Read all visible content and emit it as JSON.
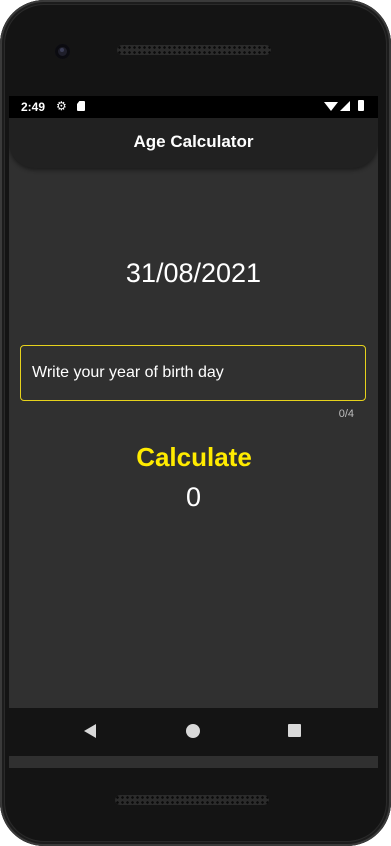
{
  "status_bar": {
    "time": "2:49",
    "icons": [
      "settings-gear-icon",
      "sd-card-icon",
      "wifi-icon",
      "cell-signal-icon",
      "battery-icon"
    ]
  },
  "app_bar": {
    "title": "Age Calculator"
  },
  "main": {
    "current_date": "31/08/2021",
    "birth_year_input": {
      "placeholder": "Write your year of birth day",
      "value": ""
    },
    "char_counter": "0/4",
    "calculate_label": "Calculate",
    "result": "0"
  },
  "nav_bar": {
    "icons": [
      "back-icon",
      "home-icon",
      "recents-icon"
    ]
  },
  "colors": {
    "accent": "#ffeb00",
    "input_border": "#e6d21c",
    "background": "#303030",
    "app_bar": "#212121",
    "text": "#ffffff"
  }
}
